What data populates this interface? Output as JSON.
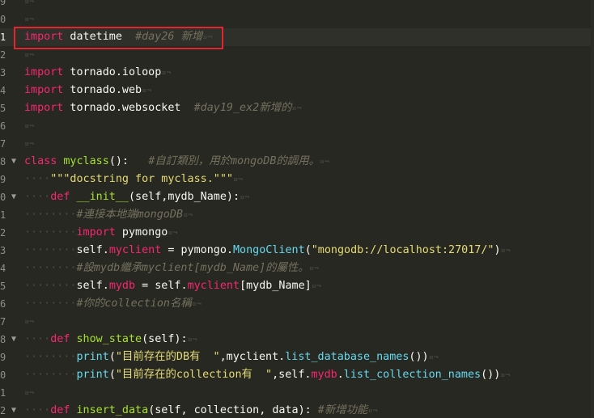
{
  "editor": {
    "active_line_index": 2,
    "line_numbers": [
      "9",
      "0",
      "1",
      "2",
      "3",
      "4",
      "5",
      "6",
      "7",
      "8",
      "9",
      "0",
      "1",
      "2",
      "3",
      "4",
      "5",
      "6",
      "7",
      "8",
      "9",
      "0",
      "1",
      "2"
    ],
    "lines": [
      {
        "fold": "",
        "tokens": []
      },
      {
        "fold": "",
        "tokens": []
      },
      {
        "fold": "",
        "tokens": [
          [
            "kw",
            "import"
          ],
          [
            "plain",
            " datetime  "
          ],
          [
            "cm",
            "#day26 新增"
          ]
        ]
      },
      {
        "fold": "",
        "tokens": []
      },
      {
        "fold": "",
        "tokens": [
          [
            "kw",
            "import"
          ],
          [
            "plain",
            " tornado.ioloop"
          ]
        ]
      },
      {
        "fold": "",
        "tokens": [
          [
            "kw",
            "import"
          ],
          [
            "plain",
            " tornado.web"
          ]
        ]
      },
      {
        "fold": "",
        "tokens": [
          [
            "kw",
            "import"
          ],
          [
            "plain",
            " tornado.websocket  "
          ],
          [
            "cm",
            "#day19_ex2新增的"
          ]
        ]
      },
      {
        "fold": "",
        "tokens": []
      },
      {
        "fold": "",
        "tokens": []
      },
      {
        "fold": "▼",
        "tokens": [
          [
            "kw",
            "class"
          ],
          [
            "plain",
            " "
          ],
          [
            "nm",
            "myclass"
          ],
          [
            "plain",
            "():   "
          ],
          [
            "cm",
            "#自訂類別，用於mongoDB的調用。"
          ]
        ]
      },
      {
        "fold": "",
        "tokens": [
          [
            "ws",
            "····"
          ],
          [
            "st",
            "\"\"\"docstring for myclass.\"\"\""
          ]
        ]
      },
      {
        "fold": "▼",
        "tokens": [
          [
            "ws",
            "····"
          ],
          [
            "kw",
            "def"
          ],
          [
            "plain",
            " "
          ],
          [
            "nm",
            "__init__"
          ],
          [
            "plain",
            "(self,mydb_Name):"
          ]
        ]
      },
      {
        "fold": "",
        "tokens": [
          [
            "ws",
            "········"
          ],
          [
            "cm",
            "#連接本地端mongoDB"
          ]
        ]
      },
      {
        "fold": "",
        "tokens": [
          [
            "ws",
            "········"
          ],
          [
            "kw",
            "import"
          ],
          [
            "plain",
            " pymongo"
          ]
        ]
      },
      {
        "fold": "",
        "tokens": [
          [
            "ws",
            "········"
          ],
          [
            "plain",
            "self."
          ],
          [
            "attr",
            "myclient"
          ],
          [
            "plain",
            " = pymongo."
          ],
          [
            "bi",
            "MongoClient"
          ],
          [
            "plain",
            "("
          ],
          [
            "st",
            "\"mongodb://localhost:27017/\""
          ],
          [
            "plain",
            ")"
          ]
        ]
      },
      {
        "fold": "",
        "tokens": [
          [
            "ws",
            "········"
          ],
          [
            "cm",
            "#設mydb繼承myclient[mydb_Name]的屬性。"
          ]
        ]
      },
      {
        "fold": "",
        "tokens": [
          [
            "ws",
            "········"
          ],
          [
            "plain",
            "self."
          ],
          [
            "attr",
            "mydb"
          ],
          [
            "plain",
            " = self."
          ],
          [
            "attr",
            "myclient"
          ],
          [
            "plain",
            "[mydb_Name]"
          ]
        ]
      },
      {
        "fold": "",
        "tokens": [
          [
            "ws",
            "········"
          ],
          [
            "cm",
            "#你的collection名稱"
          ]
        ]
      },
      {
        "fold": "",
        "tokens": []
      },
      {
        "fold": "▼",
        "tokens": [
          [
            "ws",
            "····"
          ],
          [
            "kw",
            "def"
          ],
          [
            "plain",
            " "
          ],
          [
            "nm",
            "show_state"
          ],
          [
            "plain",
            "(self):"
          ]
        ]
      },
      {
        "fold": "",
        "tokens": [
          [
            "ws",
            "········"
          ],
          [
            "bi",
            "print"
          ],
          [
            "plain",
            "("
          ],
          [
            "st",
            "\"目前存在的DB有  \""
          ],
          [
            "plain",
            ",myclient."
          ],
          [
            "bi",
            "list_database_names"
          ],
          [
            "plain",
            "())"
          ]
        ]
      },
      {
        "fold": "",
        "tokens": [
          [
            "ws",
            "········"
          ],
          [
            "bi",
            "print"
          ],
          [
            "plain",
            "("
          ],
          [
            "st",
            "\"目前存在的collection有  \""
          ],
          [
            "plain",
            ",self."
          ],
          [
            "attr",
            "mydb"
          ],
          [
            "plain",
            "."
          ],
          [
            "bi",
            "list_collection_names"
          ],
          [
            "plain",
            "())"
          ]
        ]
      },
      {
        "fold": "",
        "tokens": []
      },
      {
        "fold": "▼",
        "tokens": [
          [
            "ws",
            "····"
          ],
          [
            "kw",
            "def"
          ],
          [
            "plain",
            " "
          ],
          [
            "nm",
            "insert_data"
          ],
          [
            "plain",
            "(self, collection, data): "
          ],
          [
            "cm",
            "#新增功能"
          ]
        ]
      }
    ],
    "eol_marker": "¤¬"
  }
}
